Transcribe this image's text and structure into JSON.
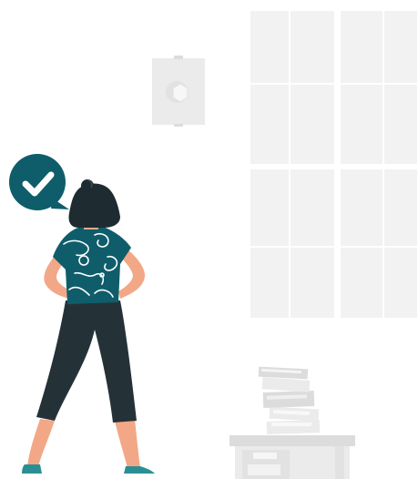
{
  "illustration": {
    "colors": {
      "background": "#ffffff",
      "window_pane": "#f2f2f2",
      "window_frame": "#ffffff",
      "frame_light": "#ececec",
      "furniture": "#ebebeb",
      "furniture_dark": "#dcdcdc",
      "accent_teal": "#0f5d6b",
      "hair_dark": "#1e2b30",
      "pants_dark": "#243238",
      "skin": "#f2a886",
      "shoe_teal": "#2a8f94",
      "pattern_light": "#ffffff"
    },
    "icons": {
      "badge": "check-icon",
      "wall_clock": "hexagon-icon"
    }
  }
}
